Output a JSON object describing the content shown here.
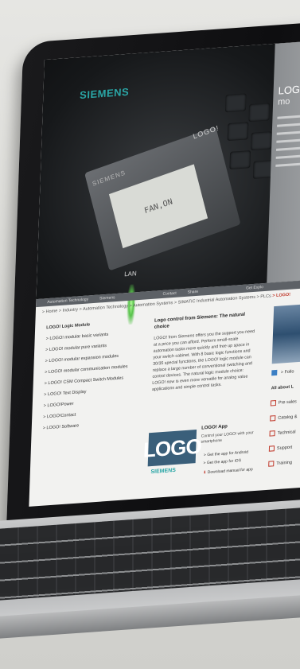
{
  "hero": {
    "brand": "SIEMENS",
    "module_name": "LOGO!",
    "module_brand": "SIEMENS",
    "display_text": "FAN,ON",
    "lan_label": "LAN",
    "side_title": "LOGO",
    "side_sub": "mo"
  },
  "nav": {
    "items": [
      "Automation Technology",
      "Siemens",
      "Contact",
      "Share",
      "Get Explo"
    ]
  },
  "breadcrumb": {
    "path": "> Home  > Industry  > Automation Technology  > Automation Systems  > SIMATIC Industrial Automation Systems  > PLCs",
    "current": "> LOGO!"
  },
  "left_nav": {
    "heading": "LOGO! Logic Module",
    "items": [
      "> LOGO! modular basic variants",
      "> LOGO! modular pure variants",
      "> LOGO! modular expansion modules",
      "> LOGO! modular communication modules",
      "> LOGO! CSM Compact Switch Modules",
      "> LOGO! Text Display",
      "> LOGO!Power",
      "> LOGO!Contact",
      "> LOGO! Software"
    ]
  },
  "content": {
    "title": "Logo control from Siemens: The natural choice",
    "body": "LOGO! from Siemens offers you the support you need at a price you can afford. Perform small-scale automation tasks more quickly and free up space in your switch cabinet. With 8 basic logic functions and 30/35 special functions, the LOGO! logic module can replace a large number of conventional switching and control devices. The natural logic module choice: LOGO! now is even more versatile for analog value applications and simple control tasks."
  },
  "app": {
    "logo_text": "LOGO",
    "brand": "SIEMENS",
    "title": "LOGO! App",
    "desc": "Control your LOGO! with your smartphone",
    "link_android": "> Get the app for Android",
    "link_ios": "> Get the app for iOS",
    "link_manual": "Download manual for app"
  },
  "right": {
    "follow": "> Follo",
    "about": "All about L",
    "links": [
      "Pre sales",
      "Catalog &",
      "Technical",
      "Support",
      "Training"
    ]
  }
}
